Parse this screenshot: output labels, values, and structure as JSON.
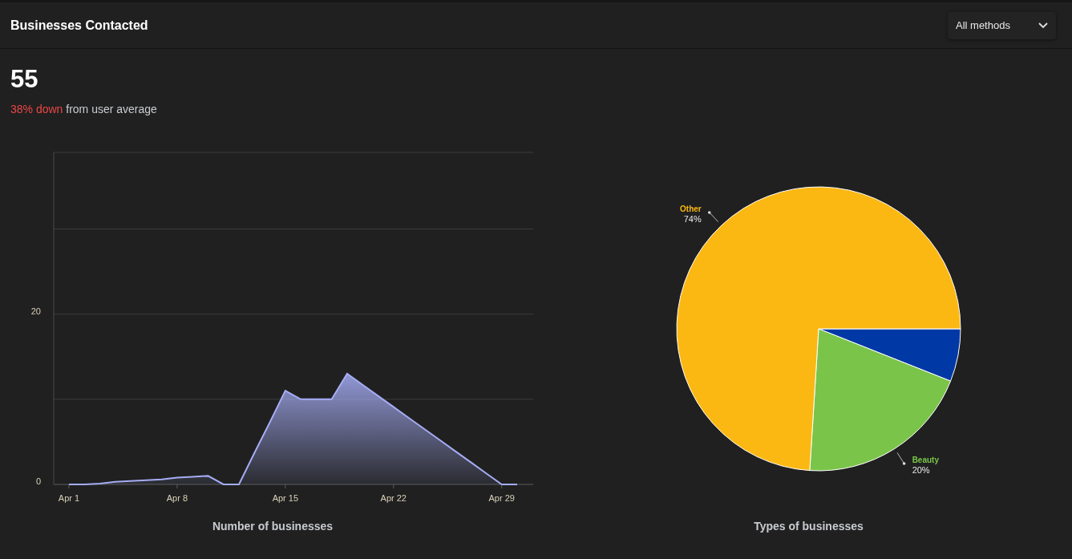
{
  "header": {
    "title": "Businesses Contacted",
    "filter": {
      "value": "All methods"
    }
  },
  "summary": {
    "total": "55",
    "change": "38% down",
    "change_suffix": "from user average"
  },
  "charts": [
    {
      "chart_data": {
        "type": "area",
        "title": "Number of businesses",
        "categories": [
          "Apr 1",
          null,
          null,
          null,
          null,
          null,
          null,
          "Apr 8",
          null,
          null,
          null,
          null,
          null,
          null,
          "Apr 15",
          null,
          null,
          null,
          null,
          null,
          null,
          "Apr 22",
          null,
          null,
          null,
          null,
          null,
          null,
          "Apr 29",
          null
        ],
        "series": [
          {
            "color": "#a5adf5",
            "values": [
              0,
              0,
              0.1,
              0.3,
              0.4,
              0.5,
              0.6,
              0.8,
              0.9,
              1,
              0,
              0,
              3.7,
              7.3,
              11,
              10,
              10,
              10,
              13,
              11.7,
              10.4,
              9.1,
              7.8,
              6.5,
              5.2,
              3.9,
              2.6,
              1.3,
              0,
              0
            ]
          }
        ],
        "ylim": [
          0,
          39
        ],
        "yticks": [
          0,
          20
        ]
      }
    },
    {
      "chart_data": {
        "type": "pie",
        "title": "Types of businesses",
        "categories": [
          null,
          "Beauty",
          "Other"
        ],
        "series": [
          {
            "values": [
              6,
              20,
              74
            ]
          }
        ],
        "colors": [
          "#0039a6",
          "#7ac44a",
          "#fbb812"
        ],
        "value_labels": [
          null,
          "20%",
          "74%"
        ]
      }
    }
  ]
}
